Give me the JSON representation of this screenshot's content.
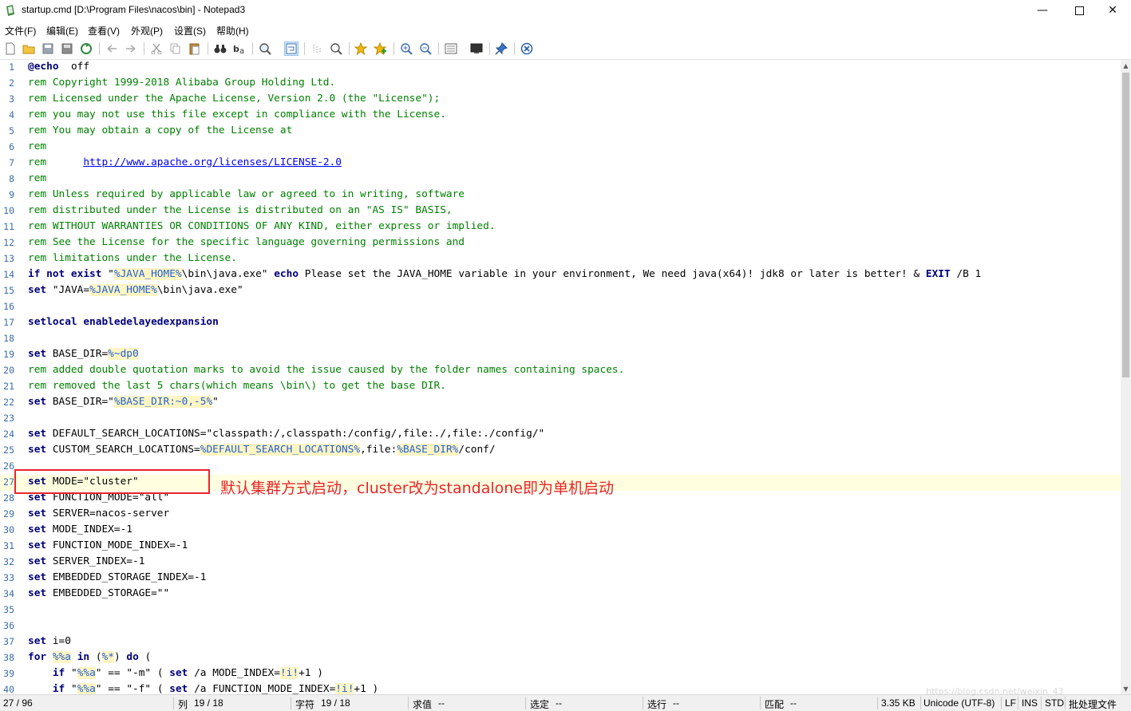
{
  "window": {
    "title": "startup.cmd [D:\\Program Files\\nacos\\bin] - Notepad3"
  },
  "menu": [
    "文件(F)",
    "编辑(E)",
    "查看(V)",
    "外观(P)",
    "设置(S)",
    "帮助(H)"
  ],
  "editor": {
    "current_line": 27,
    "lines": [
      {
        "n": 1,
        "parts": [
          [
            "kw",
            "@echo"
          ],
          [
            "",
            "  off"
          ]
        ]
      },
      {
        "n": 2,
        "parts": [
          [
            "cm",
            "rem Copyright 1999-2018 Alibaba Group Holding Ltd."
          ]
        ]
      },
      {
        "n": 3,
        "parts": [
          [
            "cm",
            "rem Licensed under the Apache License, Version 2.0 (the \"License\");"
          ]
        ]
      },
      {
        "n": 4,
        "parts": [
          [
            "cm",
            "rem you may not use this file except in compliance with the License."
          ]
        ]
      },
      {
        "n": 5,
        "parts": [
          [
            "cm",
            "rem You may obtain a copy of the License at"
          ]
        ]
      },
      {
        "n": 6,
        "parts": [
          [
            "cm",
            "rem"
          ]
        ]
      },
      {
        "n": 7,
        "parts": [
          [
            "cm",
            "rem      "
          ],
          [
            "lnk",
            "http://www.apache.org/licenses/LICENSE-2.0"
          ]
        ]
      },
      {
        "n": 8,
        "parts": [
          [
            "cm",
            "rem"
          ]
        ]
      },
      {
        "n": 9,
        "parts": [
          [
            "cm",
            "rem Unless required by applicable law or agreed to in writing, software"
          ]
        ]
      },
      {
        "n": 10,
        "parts": [
          [
            "cm",
            "rem distributed under the License is distributed on an \"AS IS\" BASIS,"
          ]
        ]
      },
      {
        "n": 11,
        "parts": [
          [
            "cm",
            "rem WITHOUT WARRANTIES OR CONDITIONS OF ANY KIND, either express or implied."
          ]
        ]
      },
      {
        "n": 12,
        "parts": [
          [
            "cm",
            "rem See the License for the specific language governing permissions and"
          ]
        ]
      },
      {
        "n": 13,
        "parts": [
          [
            "cm",
            "rem limitations under the License."
          ]
        ]
      },
      {
        "n": 14,
        "parts": [
          [
            "kw",
            "if not exist"
          ],
          [
            "",
            " \""
          ],
          [
            "var",
            "%JAVA_HOME%"
          ],
          [
            "",
            "\\bin\\java.exe\" "
          ],
          [
            "kw",
            "echo"
          ],
          [
            "",
            " Please set the JAVA_HOME variable in your environment, We need java(x64)! jdk8 or later is better! & "
          ],
          [
            "kw",
            "EXIT"
          ],
          [
            "",
            " /B 1"
          ]
        ]
      },
      {
        "n": 15,
        "parts": [
          [
            "kw",
            "set"
          ],
          [
            "",
            " \"JAVA="
          ],
          [
            "var",
            "%JAVA_HOME%"
          ],
          [
            "",
            "\\bin\\java.exe\""
          ]
        ]
      },
      {
        "n": 16,
        "parts": []
      },
      {
        "n": 17,
        "parts": [
          [
            "kw",
            "setlocal enabledelayedexpansion"
          ]
        ]
      },
      {
        "n": 18,
        "parts": []
      },
      {
        "n": 19,
        "parts": [
          [
            "kw",
            "set"
          ],
          [
            "",
            " BASE_DIR="
          ],
          [
            "var",
            "%~dp0"
          ]
        ]
      },
      {
        "n": 20,
        "parts": [
          [
            "cm",
            "rem added double quotation marks to avoid the issue caused by the folder names containing spaces."
          ]
        ]
      },
      {
        "n": 21,
        "parts": [
          [
            "cm",
            "rem removed the last 5 chars(which means \\bin\\) to get the base DIR."
          ]
        ]
      },
      {
        "n": 22,
        "parts": [
          [
            "kw",
            "set"
          ],
          [
            "",
            " BASE_DIR=\""
          ],
          [
            "var",
            "%BASE_DIR:~0,-5%"
          ],
          [
            "",
            "\""
          ]
        ]
      },
      {
        "n": 23,
        "parts": []
      },
      {
        "n": 24,
        "parts": [
          [
            "kw",
            "set"
          ],
          [
            "",
            " DEFAULT_SEARCH_LOCATIONS=\"classpath:/,classpath:/config/,file:./,file:./config/\""
          ]
        ]
      },
      {
        "n": 25,
        "parts": [
          [
            "kw",
            "set"
          ],
          [
            "",
            " CUSTOM_SEARCH_LOCATIONS="
          ],
          [
            "var",
            "%DEFAULT_SEARCH_LOCATIONS%"
          ],
          [
            "",
            ",file:"
          ],
          [
            "var",
            "%BASE_DIR%"
          ],
          [
            "",
            "/conf/"
          ]
        ]
      },
      {
        "n": 26,
        "parts": []
      },
      {
        "n": 27,
        "parts": [
          [
            "kw",
            "set"
          ],
          [
            "",
            " MODE=\"cluster\""
          ]
        ]
      },
      {
        "n": 28,
        "parts": [
          [
            "kw",
            "set"
          ],
          [
            "",
            " FUNCTION_MODE=\"all\""
          ]
        ]
      },
      {
        "n": 29,
        "parts": [
          [
            "kw",
            "set"
          ],
          [
            "",
            " SERVER=nacos-server"
          ]
        ]
      },
      {
        "n": 30,
        "parts": [
          [
            "kw",
            "set"
          ],
          [
            "",
            " MODE_INDEX=-1"
          ]
        ]
      },
      {
        "n": 31,
        "parts": [
          [
            "kw",
            "set"
          ],
          [
            "",
            " FUNCTION_MODE_INDEX=-1"
          ]
        ]
      },
      {
        "n": 32,
        "parts": [
          [
            "kw",
            "set"
          ],
          [
            "",
            " SERVER_INDEX=-1"
          ]
        ]
      },
      {
        "n": 33,
        "parts": [
          [
            "kw",
            "set"
          ],
          [
            "",
            " EMBEDDED_STORAGE_INDEX=-1"
          ]
        ]
      },
      {
        "n": 34,
        "parts": [
          [
            "kw",
            "set"
          ],
          [
            "",
            " EMBEDDED_STORAGE=\"\""
          ]
        ]
      },
      {
        "n": 35,
        "parts": []
      },
      {
        "n": 36,
        "parts": []
      },
      {
        "n": 37,
        "parts": [
          [
            "kw",
            "set"
          ],
          [
            "",
            " i=0"
          ]
        ]
      },
      {
        "n": 38,
        "parts": [
          [
            "kw",
            "for"
          ],
          [
            "",
            " "
          ],
          [
            "var",
            "%%a"
          ],
          [
            "",
            " "
          ],
          [
            "kw",
            "in"
          ],
          [
            "",
            " ("
          ],
          [
            "var",
            "%*"
          ],
          [
            "",
            ") "
          ],
          [
            "kw",
            "do"
          ],
          [
            "",
            " ("
          ]
        ]
      },
      {
        "n": 39,
        "parts": [
          [
            "",
            "    "
          ],
          [
            "kw",
            "if"
          ],
          [
            "",
            " \""
          ],
          [
            "var",
            "%%a"
          ],
          [
            "",
            "\" == \"-m\" ( "
          ],
          [
            "kw",
            "set"
          ],
          [
            "",
            " /a MODE_INDEX="
          ],
          [
            "var",
            "!i!"
          ],
          [
            "",
            "+1 )"
          ]
        ]
      },
      {
        "n": 40,
        "parts": [
          [
            "",
            "    "
          ],
          [
            "kw",
            "if"
          ],
          [
            "",
            " \""
          ],
          [
            "var",
            "%%a"
          ],
          [
            "",
            "\" == \"-f\" ( "
          ],
          [
            "kw",
            "set"
          ],
          [
            "",
            " /a FUNCTION_MODE_INDEX="
          ],
          [
            "var",
            "!i!"
          ],
          [
            "",
            "+1 )"
          ]
        ]
      }
    ]
  },
  "annotation": {
    "text": "默认集群方式启动，cluster改为standalone即为单机启动"
  },
  "status": {
    "line": "27 / 96",
    "col_label": "列",
    "col": "19 / 18",
    "char_label": "字符",
    "char": "19 / 18",
    "eval_label": "求值",
    "eval": "--",
    "sel_label": "选定",
    "sel": "--",
    "selline_label": "选行",
    "selline": "--",
    "match_label": "匹配",
    "match": "--",
    "size": "3.35 KB",
    "encoding": "Unicode (UTF-8)",
    "eol": "LF",
    "ins": "INS",
    "std": "STD",
    "mode": "批处理文件"
  },
  "watermark": "https://blog.csdn.net/weixin_43"
}
